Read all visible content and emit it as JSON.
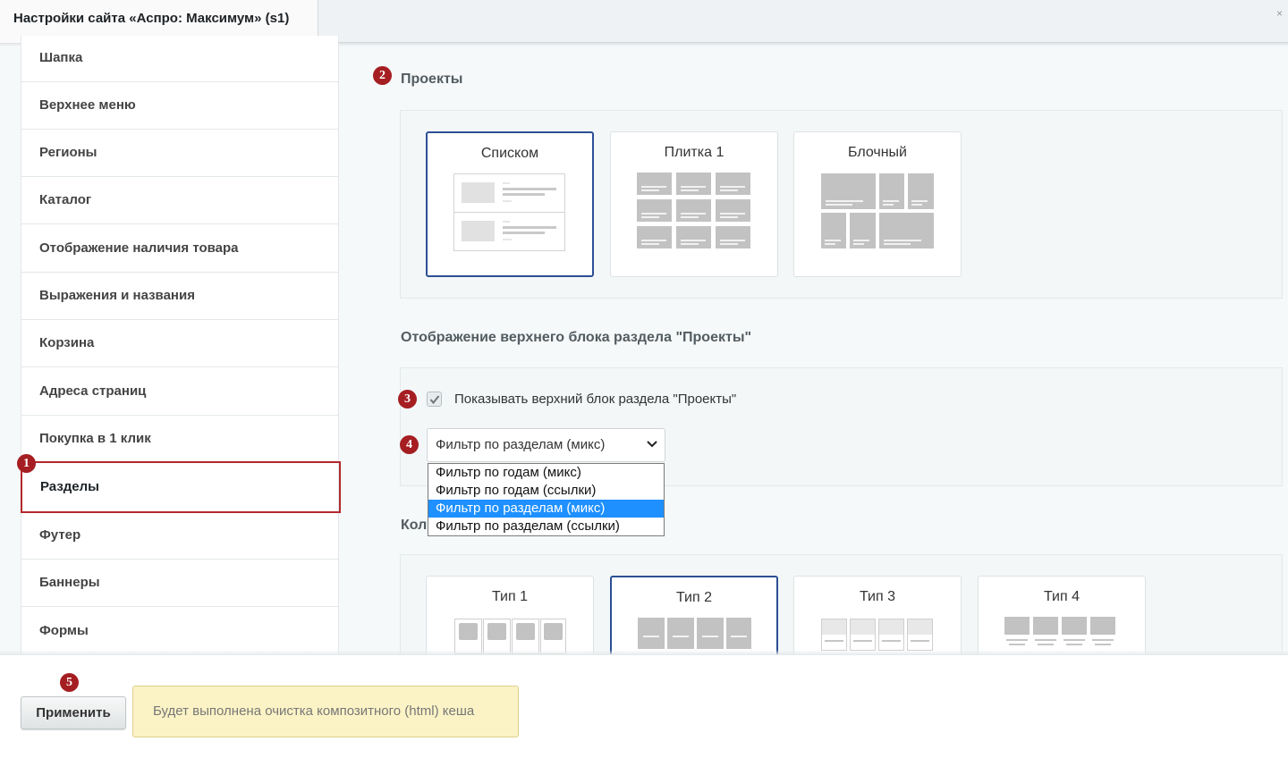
{
  "window": {
    "tab_title": "Настройки сайта «Аспро: Максимум» (s1)",
    "close_glyph": "×"
  },
  "sidebar": {
    "items": [
      {
        "label": "Шапка"
      },
      {
        "label": "Верхнее меню"
      },
      {
        "label": "Регионы"
      },
      {
        "label": "Каталог"
      },
      {
        "label": "Отображение наличия товара"
      },
      {
        "label": "Выражения и названия"
      },
      {
        "label": "Корзина"
      },
      {
        "label": "Адреса страниц"
      },
      {
        "label": "Покупка в 1 клик"
      },
      {
        "label": "Разделы",
        "active": true
      },
      {
        "label": "Футер"
      },
      {
        "label": "Баннеры"
      },
      {
        "label": "Формы"
      }
    ]
  },
  "badges": [
    "1",
    "2",
    "3",
    "4",
    "5"
  ],
  "projects": {
    "title": "Проекты",
    "options": [
      {
        "label": "Списком",
        "selected": true
      },
      {
        "label": "Плитка 1",
        "selected": false
      },
      {
        "label": "Блочный",
        "selected": false
      }
    ]
  },
  "top_block": {
    "title": "Отображение верхнего блока раздела \"Проекты\"",
    "checkbox_label": "Показывать верхний блок раздела \"Проекты\"",
    "checkbox_checked": true,
    "select_value": "Фильтр по разделам (микс)",
    "dropdown_options": [
      "Фильтр по годам (микс)",
      "Фильтр по годам (ссылки)",
      "Фильтр по разделам (микс)",
      "Фильтр по разделам (ссылки)"
    ],
    "highlighted_option": 2
  },
  "types": {
    "title_partial": "Кол",
    "options": [
      {
        "label": "Тип 1",
        "selected": false
      },
      {
        "label": "Тип 2",
        "selected": true
      },
      {
        "label": "Тип 3",
        "selected": false
      },
      {
        "label": "Тип 4",
        "selected": false
      }
    ]
  },
  "footer": {
    "apply_label": "Применить",
    "notice": "Будет выполнена очистка композитного (html) кеша"
  },
  "colors": {
    "badge": "#a51e22",
    "selected_border": "#2c4f94",
    "highlight": "#1e90ff",
    "notice_bg": "#fbf3c5"
  }
}
